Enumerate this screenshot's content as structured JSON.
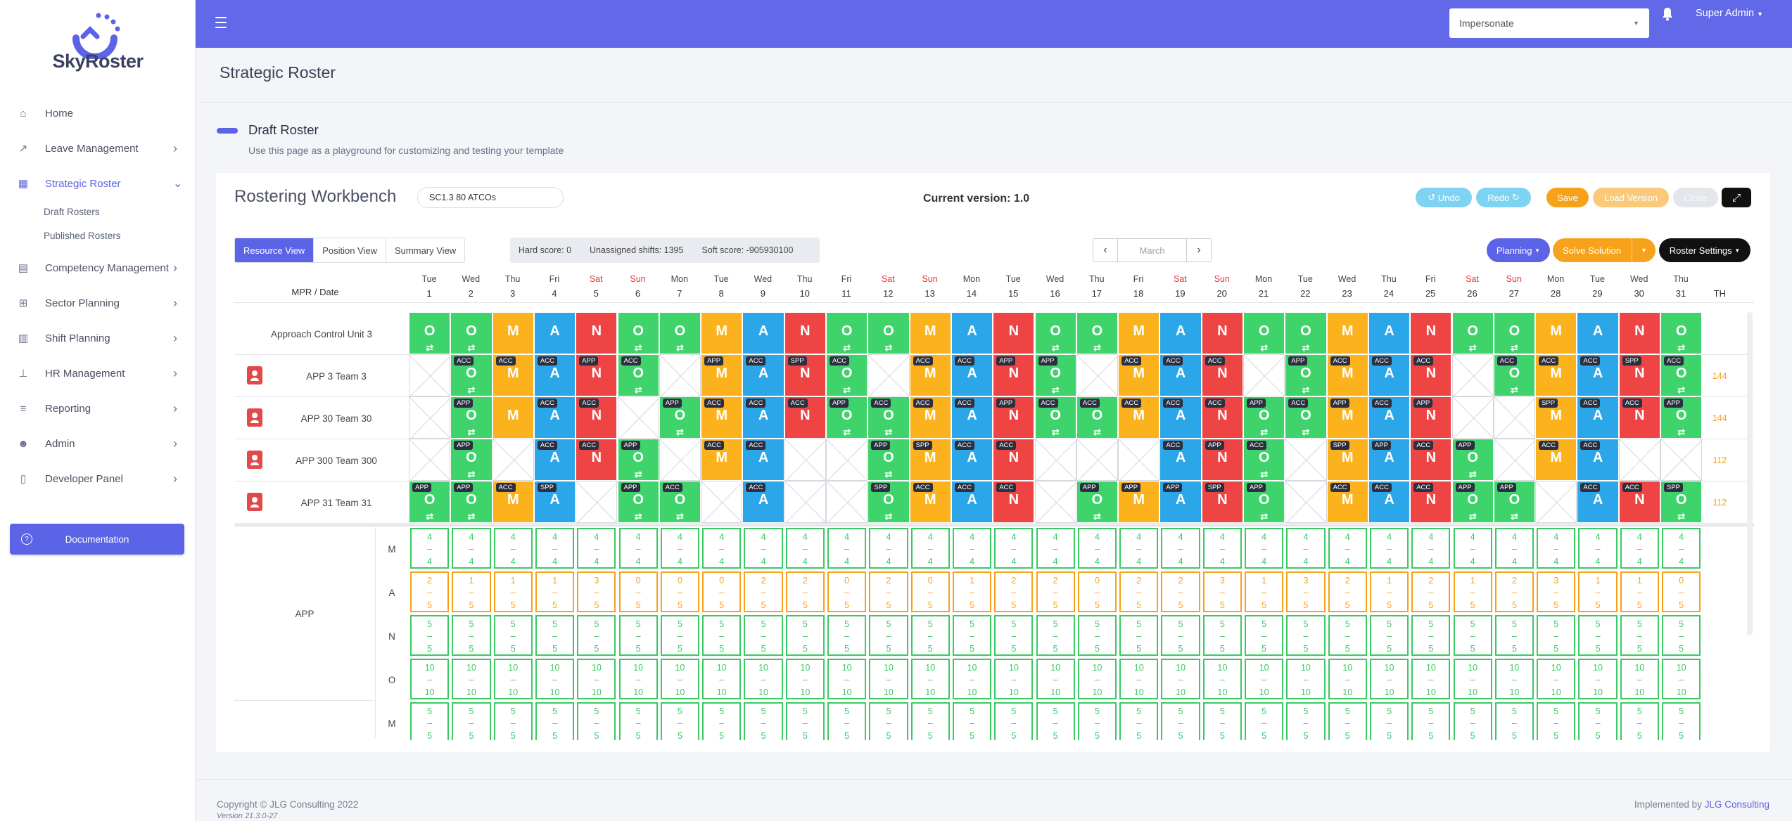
{
  "app": {
    "name": "SkyRoster"
  },
  "sidebar": {
    "items": [
      {
        "label": "Home",
        "icon": "home-icon"
      },
      {
        "label": "Leave Management",
        "icon": "chart-line-icon"
      },
      {
        "label": "Strategic Roster",
        "icon": "table-icon"
      },
      {
        "label": "Competency Management",
        "icon": "briefcase-icon"
      },
      {
        "label": "Sector Planning",
        "icon": "sitemap-icon"
      },
      {
        "label": "Shift Planning",
        "icon": "chart-bar-icon"
      },
      {
        "label": "HR Management",
        "icon": "org-chart-icon"
      },
      {
        "label": "Reporting",
        "icon": "list-icon"
      },
      {
        "label": "Admin",
        "icon": "users-icon"
      },
      {
        "label": "Developer Panel",
        "icon": "columns-icon"
      }
    ],
    "sub_items": [
      "Draft Rosters",
      "Published Rosters"
    ],
    "documentation": "Documentation"
  },
  "topbar": {
    "impersonate": "Impersonate",
    "user": "Super Admin"
  },
  "page": {
    "title": "Strategic Roster",
    "draft_title": "Draft Roster",
    "draft_subtitle": "Use this page as a playground for customizing and testing your template"
  },
  "workbench": {
    "title": "Rostering Workbench",
    "input_value": "SC1.3 80 ATCOs",
    "version": "Current version: 1.0",
    "buttons": {
      "undo": "Undo",
      "redo": "Redo",
      "save": "Save",
      "load": "Load Version",
      "close": "Close"
    },
    "tabs": [
      "Resource View",
      "Position View",
      "Summary View"
    ],
    "scores": {
      "hard": "Hard score: 0",
      "unassigned": "Unassigned shifts: 1395",
      "soft": "Soft score: -905930100"
    },
    "month": "March",
    "planning": "Planning",
    "solve": "Solve Solution",
    "roster_settings": "Roster Settings"
  },
  "grid": {
    "corner": "MPR / Date",
    "th_header": "TH",
    "days": [
      "Tue",
      "Wed",
      "Thu",
      "Fri",
      "Sat",
      "Sun",
      "Mon",
      "Tue",
      "Wed",
      "Thu",
      "Fri",
      "Sat",
      "Sun",
      "Mon",
      "Tue",
      "Wed",
      "Thu",
      "Fri",
      "Sat",
      "Sun",
      "Mon",
      "Tue",
      "Wed",
      "Thu",
      "Fri",
      "Sat",
      "Sun",
      "Mon",
      "Tue",
      "Wed",
      "Thu"
    ],
    "weekend_indexes": [
      4,
      5,
      11,
      12,
      18,
      19,
      25,
      26
    ],
    "colors": {
      "O": "#3fd36b",
      "M": "#fbb21c",
      "A": "#2ba6e8",
      "N": "#ef4444"
    },
    "rows": [
      {
        "label": "Approach Control Unit 3",
        "person": false,
        "th": "",
        "cells": [
          "O",
          "O",
          "M",
          "A",
          "N",
          "O",
          "O",
          "M",
          "A",
          "N",
          "O",
          "O",
          "M",
          "A",
          "N",
          "O",
          "O",
          "M",
          "A",
          "N",
          "O",
          "O",
          "M",
          "A",
          "N",
          "O",
          "O",
          "M",
          "A",
          "N",
          "O"
        ],
        "tags": [
          "",
          "",
          "",
          "",
          "",
          "",
          "",
          "",
          "",
          "",
          "",
          "",
          "",
          "",
          "",
          "",
          "",
          "",
          "",
          "",
          "",
          "",
          "",
          "",
          "",
          "",
          "",
          "",
          "",
          "",
          ""
        ]
      },
      {
        "label": "APP 3 Team 3",
        "person": true,
        "th": "144",
        "cells": [
          "",
          "O",
          "M",
          "A",
          "N",
          "O",
          "",
          "M",
          "A",
          "N",
          "O",
          "",
          "M",
          "A",
          "N",
          "O",
          "",
          "M",
          "A",
          "N",
          "",
          "O",
          "M",
          "A",
          "N",
          "",
          "O",
          "M",
          "A",
          "N",
          "O"
        ],
        "tags": [
          "",
          "ACC",
          "ACC",
          "ACC",
          "APP",
          "ACC",
          "",
          "APP",
          "ACC",
          "SPP",
          "ACC",
          "",
          "ACC",
          "ACC",
          "APP",
          "APP",
          "",
          "ACC",
          "ACC",
          "ACC",
          "",
          "APP",
          "ACC",
          "ACC",
          "ACC",
          "",
          "ACC",
          "ACC",
          "ACC",
          "SPP",
          "ACC"
        ]
      },
      {
        "label": "APP 30 Team 30",
        "person": true,
        "th": "144",
        "cells": [
          "",
          "O",
          "M",
          "A",
          "N",
          "",
          "O",
          "M",
          "A",
          "N",
          "O",
          "O",
          "M",
          "A",
          "N",
          "O",
          "O",
          "M",
          "A",
          "N",
          "O",
          "O",
          "M",
          "A",
          "N",
          "",
          "",
          "M",
          "A",
          "N",
          "O"
        ],
        "tags": [
          "",
          "APP",
          "",
          "ACC",
          "ACC",
          "",
          "APP",
          "ACC",
          "ACC",
          "ACC",
          "APP",
          "ACC",
          "ACC",
          "ACC",
          "APP",
          "ACC",
          "ACC",
          "ACC",
          "ACC",
          "ACC",
          "APP",
          "ACC",
          "APP",
          "ACC",
          "APP",
          "",
          "",
          "SPP",
          "ACC",
          "ACC",
          "APP"
        ]
      },
      {
        "label": "APP 300 Team 300",
        "person": true,
        "th": "112",
        "cells": [
          "",
          "O",
          "",
          "A",
          "N",
          "O",
          "",
          "M",
          "A",
          "",
          "",
          "O",
          "M",
          "A",
          "N",
          "",
          "",
          "",
          "A",
          "N",
          "O",
          "",
          "M",
          "A",
          "N",
          "O",
          "",
          "M",
          "A",
          "",
          ""
        ],
        "tags": [
          "",
          "APP",
          "",
          "ACC",
          "ACC",
          "APP",
          "",
          "ACC",
          "ACC",
          "",
          "",
          "APP",
          "SPP",
          "ACC",
          "ACC",
          "",
          "",
          "",
          "ACC",
          "APP",
          "ACC",
          "",
          "SPP",
          "APP",
          "ACC",
          "APP",
          "",
          "ACC",
          "ACC",
          "",
          ""
        ]
      },
      {
        "label": "APP 31 Team 31",
        "person": true,
        "th": "112",
        "cells": [
          "O",
          "O",
          "M",
          "A",
          "",
          "O",
          "O",
          "",
          "A",
          "",
          "",
          "O",
          "M",
          "A",
          "N",
          "",
          "O",
          "M",
          "A",
          "N",
          "O",
          "",
          "M",
          "A",
          "N",
          "O",
          "O",
          "",
          "A",
          "N",
          "O"
        ],
        "tags": [
          "APP",
          "APP",
          "ACC",
          "SPP",
          "",
          "APP",
          "ACC",
          "",
          "ACC",
          "",
          "",
          "SPP",
          "ACC",
          "ACC",
          "ACC",
          "",
          "APP",
          "APP",
          "APP",
          "SPP",
          "APP",
          "",
          "ACC",
          "ACC",
          "ACC",
          "APP",
          "APP",
          "",
          "ACC",
          "ACC",
          "SPP"
        ]
      }
    ],
    "coverage_group": "APP",
    "coverage": [
      {
        "shift": "M",
        "top": [
          "4",
          "4",
          "4",
          "4",
          "4",
          "4",
          "4",
          "4",
          "4",
          "4",
          "4",
          "4",
          "4",
          "4",
          "4",
          "4",
          "4",
          "4",
          "4",
          "4",
          "4",
          "4",
          "4",
          "4",
          "4",
          "4",
          "4",
          "4",
          "4",
          "4",
          "4"
        ],
        "bottom": [
          "4",
          "4",
          "4",
          "4",
          "4",
          "4",
          "4",
          "4",
          "4",
          "4",
          "4",
          "4",
          "4",
          "4",
          "4",
          "4",
          "4",
          "4",
          "4",
          "4",
          "4",
          "4",
          "4",
          "4",
          "4",
          "4",
          "4",
          "4",
          "4",
          "4",
          "4"
        ],
        "warn": false
      },
      {
        "shift": "A",
        "top": [
          "2",
          "1",
          "1",
          "1",
          "3",
          "0",
          "0",
          "0",
          "2",
          "2",
          "0",
          "2",
          "0",
          "1",
          "2",
          "2",
          "0",
          "2",
          "2",
          "3",
          "1",
          "3",
          "2",
          "1",
          "2",
          "1",
          "2",
          "3",
          "1",
          "1",
          "0"
        ],
        "bottom": [
          "5",
          "5",
          "5",
          "5",
          "5",
          "5",
          "5",
          "5",
          "5",
          "5",
          "5",
          "5",
          "5",
          "5",
          "5",
          "5",
          "5",
          "5",
          "5",
          "5",
          "5",
          "5",
          "5",
          "5",
          "5",
          "5",
          "5",
          "5",
          "5",
          "5",
          "5"
        ],
        "warn": true
      },
      {
        "shift": "N",
        "top": [
          "5",
          "5",
          "5",
          "5",
          "5",
          "5",
          "5",
          "5",
          "5",
          "5",
          "5",
          "5",
          "5",
          "5",
          "5",
          "5",
          "5",
          "5",
          "5",
          "5",
          "5",
          "5",
          "5",
          "5",
          "5",
          "5",
          "5",
          "5",
          "5",
          "5",
          "5"
        ],
        "bottom": [
          "5",
          "5",
          "5",
          "5",
          "5",
          "5",
          "5",
          "5",
          "5",
          "5",
          "5",
          "5",
          "5",
          "5",
          "5",
          "5",
          "5",
          "5",
          "5",
          "5",
          "5",
          "5",
          "5",
          "5",
          "5",
          "5",
          "5",
          "5",
          "5",
          "5",
          "5"
        ],
        "warn": false
      },
      {
        "shift": "O",
        "top": [
          "10",
          "10",
          "10",
          "10",
          "10",
          "10",
          "10",
          "10",
          "10",
          "10",
          "10",
          "10",
          "10",
          "10",
          "10",
          "10",
          "10",
          "10",
          "10",
          "10",
          "10",
          "10",
          "10",
          "10",
          "10",
          "10",
          "10",
          "10",
          "10",
          "10",
          "10"
        ],
        "bottom": [
          "10",
          "10",
          "10",
          "10",
          "10",
          "10",
          "10",
          "10",
          "10",
          "10",
          "10",
          "10",
          "10",
          "10",
          "10",
          "10",
          "10",
          "10",
          "10",
          "10",
          "10",
          "10",
          "10",
          "10",
          "10",
          "10",
          "10",
          "10",
          "10",
          "10",
          "10"
        ],
        "warn": false
      },
      {
        "shift": "M",
        "top": [
          "5",
          "5",
          "5",
          "5",
          "5",
          "5",
          "5",
          "5",
          "5",
          "5",
          "5",
          "5",
          "5",
          "5",
          "5",
          "5",
          "5",
          "5",
          "5",
          "5",
          "5",
          "5",
          "5",
          "5",
          "5",
          "5",
          "5",
          "5",
          "5",
          "5",
          "5"
        ],
        "bottom": [
          "5",
          "5",
          "5",
          "5",
          "5",
          "5",
          "5",
          "5",
          "5",
          "5",
          "5",
          "5",
          "5",
          "5",
          "5",
          "5",
          "5",
          "5",
          "5",
          "5",
          "5",
          "5",
          "5",
          "5",
          "5",
          "5",
          "5",
          "5",
          "5",
          "5",
          "5"
        ],
        "warn": false
      }
    ]
  },
  "footer": {
    "copyright": "Copyright © JLG Consulting 2022",
    "version": "Version 21.3.0-27",
    "implemented": "Implemented by",
    "company": "JLG Consulting"
  }
}
